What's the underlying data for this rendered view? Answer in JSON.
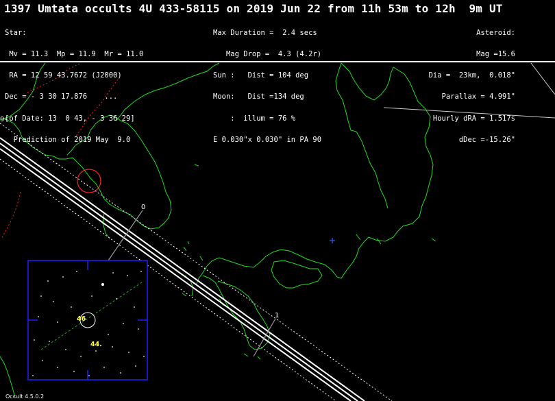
{
  "title": "1397 Umtata occults 4U 433-58115 on 2019 Jun 22 from 11h 53m to 12h  9m UT",
  "star_info": [
    "Star:",
    " Mv = 11.3  Mp = 11.9  Mr = 11.0",
    " RA = 12 59 43.7672 (J2000)",
    "Dec = - 3 30 17.876    ...",
    "[of Date: 13  0 43, - 3 36 29]",
    "  Prediction of 2019 May  9.0"
  ],
  "event_info": [
    "Max Duration =  2.4 secs",
    "   Mag Drop =  4.3 (4.2r)",
    "Sun :   Dist = 104 deg",
    "Moon:   Dist =134 deg",
    "    :  illum = 76 %",
    "E 0.030\"x 0.030\" in PA 90"
  ],
  "asteroid_info": [
    "Asteroid:",
    "Mag =15.6",
    "Dia =  23km,  0.018\"",
    "Parallax = 4.991\"",
    "Hourly dRA = 1.517s",
    "dDec =-15.26\""
  ],
  "map_labels": {
    "time_start": "0",
    "time_end": "1",
    "longitude_marker": "9-"
  },
  "finder_chart": {
    "labels": [
      "46",
      "44."
    ],
    "label_color": "#ffff40"
  },
  "footer": "Occult 4.5.0.2",
  "colors": {
    "background": "#000000",
    "coastline": "#22dd22",
    "path": "#ffffff",
    "border": "#ff2020",
    "finder_frame": "#2020ff",
    "marker": "#3060ff"
  }
}
